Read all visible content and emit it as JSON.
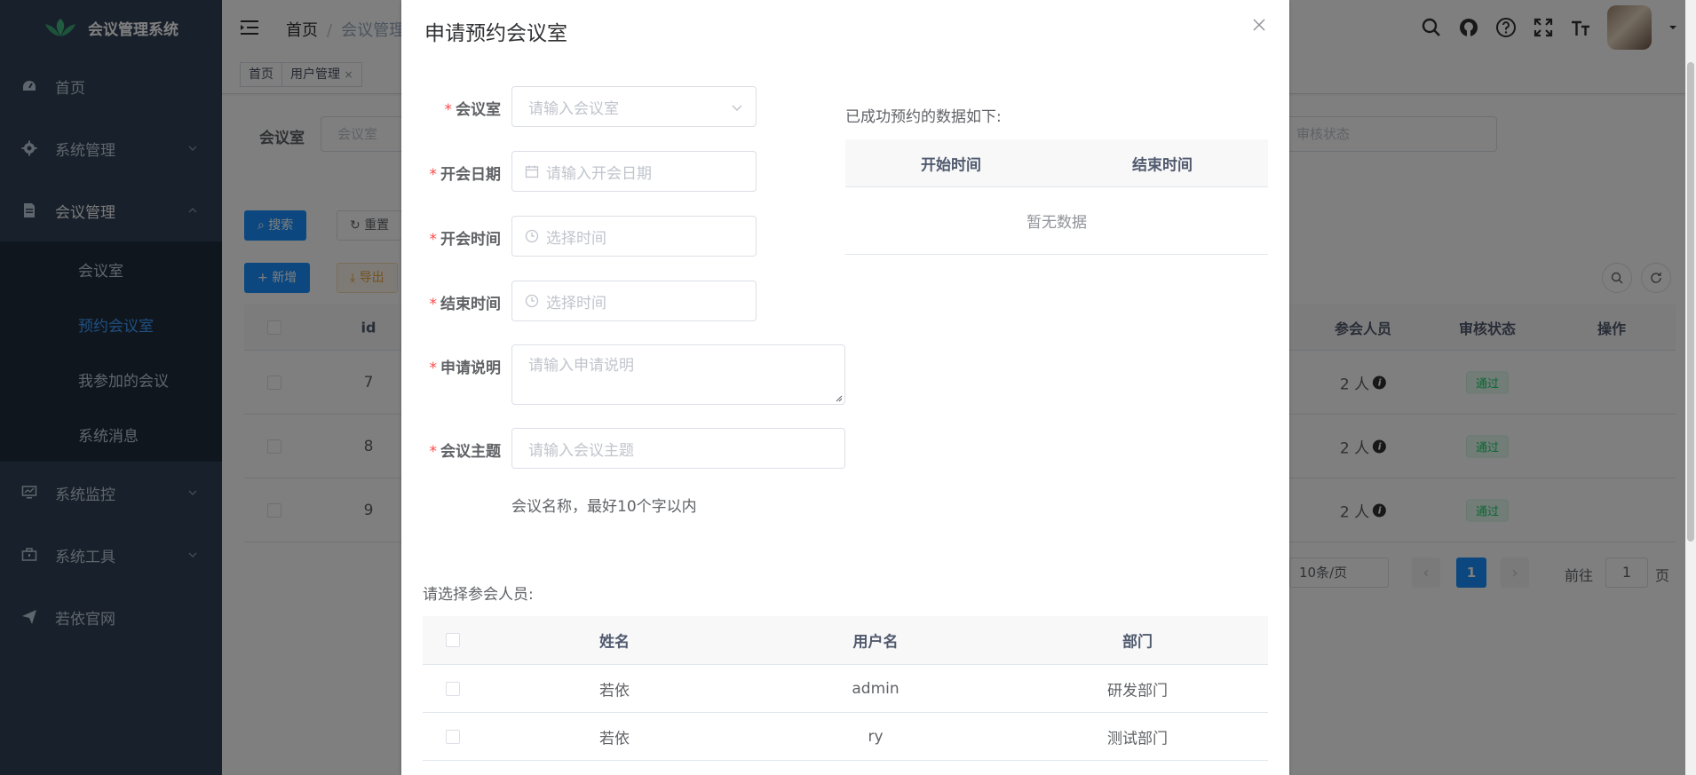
{
  "sidebar": {
    "brand_title": "会议管理系统",
    "items": [
      {
        "label": "首页"
      },
      {
        "label": "系统管理"
      },
      {
        "label": "会议管理"
      },
      {
        "label": "系统监控"
      },
      {
        "label": "系统工具"
      },
      {
        "label": "若依官网"
      }
    ],
    "sub_items": [
      {
        "label": "会议室"
      },
      {
        "label": "预约会议室"
      },
      {
        "label": "我参加的会议"
      },
      {
        "label": "系统消息"
      }
    ],
    "active_sub": "预约会议室"
  },
  "navbar": {
    "breadcrumb": [
      "首页",
      "会议管理"
    ]
  },
  "tags": [
    "首页",
    "用户管理"
  ],
  "query": {
    "room_label": "会议室",
    "room_placeholder": "会议室",
    "status_placeholder": "审核状态",
    "search_label": "搜索",
    "reset_label": "重置",
    "add_label": "新增",
    "export_label": "导出"
  },
  "table": {
    "headers": {
      "id": "id",
      "attendees": "参会人员",
      "status": "审核状态",
      "ops": "操作"
    },
    "rows": [
      {
        "id": "7",
        "attendees": "2 人",
        "status": "通过"
      },
      {
        "id": "8",
        "attendees": "2 人",
        "status": "通过"
      },
      {
        "id": "9",
        "attendees": "2 人",
        "status": "通过"
      }
    ]
  },
  "pagination": {
    "page_size": "10条/页",
    "current_page": "1",
    "goto_prefix": "前往",
    "goto_value": "1",
    "goto_suffix": "页"
  },
  "dialog": {
    "title": "申请预约会议室",
    "fields": {
      "room": {
        "label": "会议室",
        "placeholder": "请输入会议室"
      },
      "date": {
        "label": "开会日期",
        "placeholder": "请输入开会日期"
      },
      "start": {
        "label": "开会时间",
        "placeholder": "选择时间"
      },
      "end": {
        "label": "结束时间",
        "placeholder": "选择时间"
      },
      "desc": {
        "label": "申请说明",
        "placeholder": "请输入申请说明"
      },
      "topic": {
        "label": "会议主题",
        "placeholder": "请输入会议主题"
      }
    },
    "topic_hint": "会议名称，最好10个字以内",
    "booked_caption": "已成功预约的数据如下:",
    "booked_headers": [
      "开始时间",
      "结束时间"
    ],
    "booked_empty": "暂无数据",
    "participants_caption": "请选择参会人员:",
    "participants_headers": [
      "姓名",
      "用户名",
      "部门"
    ],
    "participants": [
      {
        "name": "若依",
        "username": "admin",
        "dept": "研发部门"
      },
      {
        "name": "若依",
        "username": "ry",
        "dept": "测试部门"
      }
    ]
  }
}
